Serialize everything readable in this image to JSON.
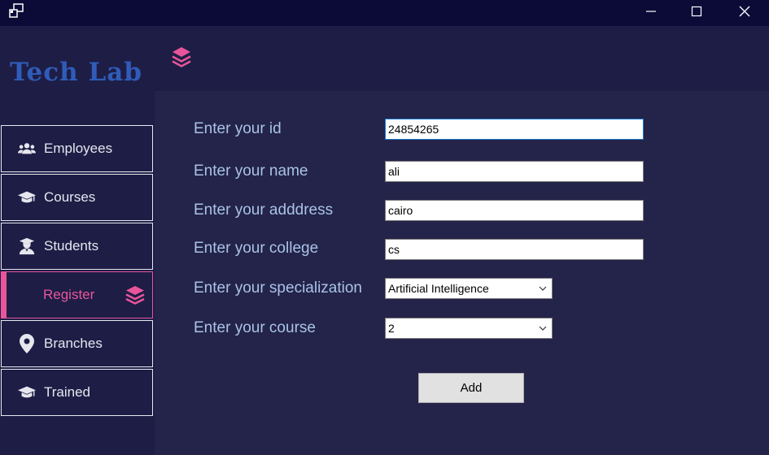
{
  "sidebar": {
    "logo": "Tech Lab",
    "items": [
      {
        "label": "Employees",
        "icon": "users-icon"
      },
      {
        "label": "Courses",
        "icon": "graduation-cap-icon"
      },
      {
        "label": "Students",
        "icon": "student-icon"
      },
      {
        "label": "Register",
        "icon": "layers-icon",
        "active": true
      },
      {
        "label": "Branches",
        "icon": "location-pin-icon"
      },
      {
        "label": "Trained",
        "icon": "graduation-cap-icon"
      }
    ]
  },
  "form": {
    "id_label": "Enter your id",
    "id_value": "24854265",
    "name_label": "Enter your name",
    "name_value": "ali",
    "address_label": "Enter your adddress",
    "address_value": "cairo",
    "college_label": "Enter your college",
    "college_value": "cs",
    "specialization_label": "Enter your specialization",
    "specialization_value": "Artificial Intelligence",
    "course_label": "Enter your course",
    "course_value": "2",
    "add_label": "Add"
  },
  "colors": {
    "accent": "#e9559a",
    "titlebar": "#0c0b38",
    "sidebar": "#1e1d46",
    "content": "#24234a",
    "logo": "#2f5cb8",
    "label": "#a9c3e6"
  }
}
